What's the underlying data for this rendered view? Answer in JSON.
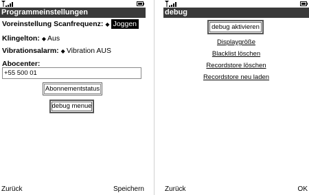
{
  "screen_left": {
    "title": "Programmeinstellungen",
    "settings": [
      {
        "label": "Voreinstellung Scanfrequenz:",
        "value": "Joggen"
      },
      {
        "label": "Klingelton:",
        "value": "Aus"
      },
      {
        "label": "Vibrationsalarm:",
        "value": "Vibration AUS"
      }
    ],
    "abocenter_label": "Abocenter:",
    "abocenter_value": "+55 500 01",
    "buttons": {
      "subscription_status": "Abonnementstatus",
      "debug_menu": "debug menue"
    },
    "softkeys": {
      "left": "Zurück",
      "right": "Speichern"
    }
  },
  "screen_right": {
    "title": "debug",
    "button": "debug aktivieren",
    "links": [
      "Displaygröße",
      "Blacklist löschen",
      "Recordstore löschen",
      "Recordstore neu laden"
    ],
    "softkeys": {
      "left": "Zurück",
      "right": "OK"
    }
  }
}
